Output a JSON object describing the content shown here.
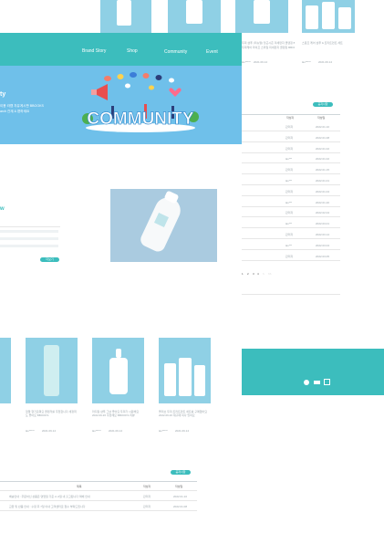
{
  "nav": {
    "items": [
      "Brand Story",
      "Shop",
      "Community",
      "Event"
    ]
  },
  "hero": {
    "side_title": "ty",
    "side_desc": [
      "이용 라뗌 자유게시판 BBOOKS",
      "arch 관계 & 편하세요"
    ],
    "banner_word": "COMMUNITY"
  },
  "review": {
    "side_title": "w",
    "more": "더보기"
  },
  "right_panel": {
    "more": "공지사항",
    "headers": [
      "작성자",
      "작성일"
    ],
    "rows": [
      {
        "author": "관리자",
        "date": "2022.01.10"
      },
      {
        "author": "관리자",
        "date": "2022.01.08"
      },
      {
        "author": "관리자",
        "date": "2022.01.02"
      },
      {
        "author": "lav***",
        "date": "2022.01.02"
      },
      {
        "author": "관리자",
        "date": "2022.01.15"
      },
      {
        "author": "lav***",
        "date": "2022.01.01"
      },
      {
        "author": "관리자",
        "date": "2022.01.04"
      },
      {
        "author": "lav***",
        "date": "2022.01.20"
      },
      {
        "author": "관리자",
        "date": "2022.02.04"
      },
      {
        "author": "lav***",
        "date": "2022.03.01"
      },
      {
        "author": "관리자",
        "date": "2022.03.14"
      },
      {
        "author": "lav***",
        "date": "2022.03.04"
      },
      {
        "author": "관리자",
        "date": "2022.03.05"
      }
    ],
    "pagination": [
      "1",
      "2",
      "3",
      "4",
      ">",
      ">>"
    ]
  },
  "top_products": {
    "captions": [
      "두피 샴푸 (리뉴얼) 당근시즌 미세먼지 클렌징 BBOOKS",
      "두피케어 라이프 스타일 미세먼지 클렌징 BBOOKS",
      "스칼프 케어 샴푸 & 트리트먼트 세트"
    ],
    "authors": [
      "lav*****",
      "lav*****"
    ],
    "dates": [
      "2021.09.14",
      "2021.09.14"
    ]
  },
  "products": [
    {
      "caption": "정말 향기로워요 클렌저를 추천합니다 세정력도 좋아요 BBOOKS",
      "author": "lav*****",
      "date": "2021.09.14"
    },
    {
      "caption": "라디칼 샴푸 그냥 좋아요 두피가 시원해요 2022.09.26 추천해요 BBOOKS 리뷰",
      "author": "lav*****",
      "date": "2021.09.14"
    },
    {
      "caption": "올리브 두피 트리트먼트 세트를 구매했어요 2022.09.26 재구매 의사 있어요",
      "author": "lav*****",
      "date": "2021.09.14"
    }
  ],
  "bottom_table": {
    "more": "공지사항",
    "headers": [
      "제목",
      "작성자",
      "작성일"
    ],
    "rows": [
      {
        "title": "배송안내 : 주문하신 상품은 영업일 기준 2~3일 내 출고됩니다 택배 안내",
        "author": "관리자",
        "date": "2022.01.10"
      },
      {
        "title": "교환 및 반품 안내 : 수령 후 7일 이내 고객센터로 접수 부탁드립니다",
        "author": "관리자",
        "date": "2022.01.08"
      }
    ]
  },
  "colors": {
    "teal": "#3cbdbd",
    "blue": "#6fc0ea",
    "thumb": "#8fd0e5"
  }
}
